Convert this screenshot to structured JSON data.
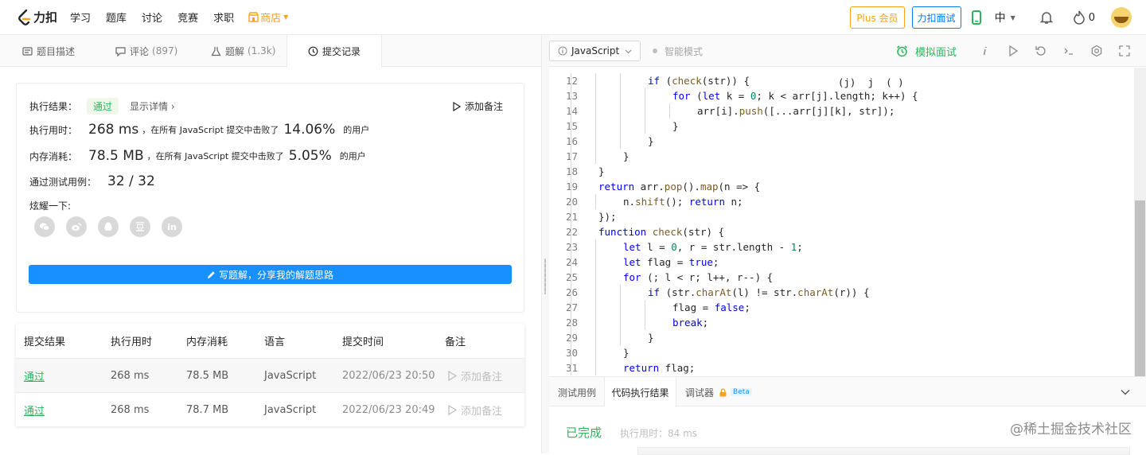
{
  "nav": {
    "logo_text": "力扣",
    "items": [
      "学习",
      "题库",
      "讨论",
      "竞赛",
      "求职"
    ],
    "shop_label": "商店",
    "plus_label": "Plus 会员",
    "interview_label": "力扣面试",
    "lang_label": "中",
    "fire_count": "0"
  },
  "tabs": [
    {
      "label": "题目描述",
      "count": ""
    },
    {
      "label": "评论",
      "count": "(897)"
    },
    {
      "label": "题解",
      "count": "(1.3k)"
    },
    {
      "label": "提交记录",
      "count": ""
    }
  ],
  "result": {
    "label": "执行结果：",
    "status": "通过",
    "detail_link": "显示详情 ›",
    "add_note": "添加备注",
    "time_label": "执行用时：",
    "time_value": "268 ms",
    "time_text": "，在所有 JavaScript 提交中击败了",
    "time_pct": "14.06%",
    "users": "的用户",
    "mem_label": "内存消耗：",
    "mem_value": "78.5 MB",
    "mem_text": "，在所有 JavaScript 提交中击败了",
    "mem_pct": "5.05%",
    "cases_label": "通过测试用例：",
    "cases_value": "32 / 32",
    "share_label": "炫耀一下:",
    "write_btn": "写题解，分享我的解题思路"
  },
  "submissions": {
    "headers": [
      "提交结果",
      "执行用时",
      "内存消耗",
      "语言",
      "提交时间",
      "备注"
    ],
    "rows": [
      {
        "status": "通过",
        "time": "268 ms",
        "memory": "78.5 MB",
        "lang": "JavaScript",
        "submitted": "2022/06/23 20:50",
        "note": "添加备注"
      },
      {
        "status": "通过",
        "time": "268 ms",
        "memory": "78.7 MB",
        "lang": "JavaScript",
        "submitted": "2022/06/23 20:49",
        "note": "添加备注"
      }
    ]
  },
  "editor": {
    "language": "JavaScript",
    "smart_mode": "智能模式",
    "mock_interview": "模拟面试",
    "bottom_tabs": [
      "测试用例",
      "代码执行结果",
      "调试器"
    ],
    "beta": "Beta",
    "done": "已完成",
    "exec_time": "执行用时：84 ms",
    "watermark": "@稀土掘金技术社区"
  },
  "code_lines": [
    {
      "n": "12",
      "indent": 4,
      "text": "if (check(str)) {"
    },
    {
      "n": "13",
      "indent": 5,
      "text": "for (let k = 0; k < arr[j].length; k++) {"
    },
    {
      "n": "14",
      "indent": 6,
      "text": "arr[i].push([...arr[j][k], str]);"
    },
    {
      "n": "15",
      "indent": 5,
      "text": "}"
    },
    {
      "n": "16",
      "indent": 4,
      "text": "}"
    },
    {
      "n": "17",
      "indent": 3,
      "text": "}"
    },
    {
      "n": "18",
      "indent": 2,
      "text": "}"
    },
    {
      "n": "19",
      "indent": 2,
      "text": "return arr.pop().map(n => {"
    },
    {
      "n": "20",
      "indent": 3,
      "text": "n.shift(); return n;"
    },
    {
      "n": "21",
      "indent": 2,
      "text": "});"
    },
    {
      "n": "22",
      "indent": 2,
      "text": "function check(str) {"
    },
    {
      "n": "23",
      "indent": 3,
      "text": "let l = 0, r = str.length - 1;"
    },
    {
      "n": "24",
      "indent": 3,
      "text": "let flag = true;"
    },
    {
      "n": "25",
      "indent": 3,
      "text": "for (; l < r; l++, r--) {"
    },
    {
      "n": "26",
      "indent": 4,
      "text": "if (str.charAt(l) != str.charAt(r)) {"
    },
    {
      "n": "27",
      "indent": 5,
      "text": "flag = false;"
    },
    {
      "n": "28",
      "indent": 5,
      "text": "break;"
    },
    {
      "n": "29",
      "indent": 4,
      "text": "}"
    },
    {
      "n": "30",
      "indent": 3,
      "text": "}"
    },
    {
      "n": "31",
      "indent": 3,
      "text": "return flag;"
    }
  ],
  "colors": {
    "accent_orange": "#ffa116",
    "accent_blue": "#007aff",
    "success_green": "#2db55d",
    "button_blue": "#1890ff"
  }
}
